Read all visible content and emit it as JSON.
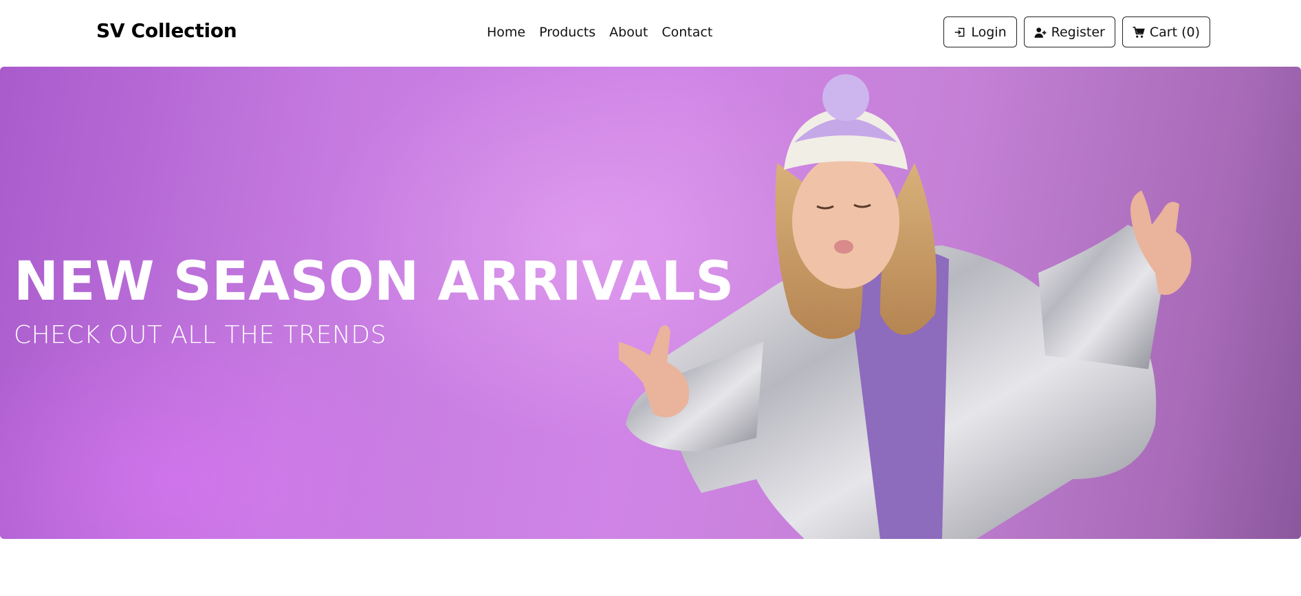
{
  "brand": "SV Collection",
  "nav": {
    "links": [
      "Home",
      "Products",
      "About",
      "Contact"
    ]
  },
  "actions": {
    "login": "Login",
    "register": "Register",
    "cart": "Cart (0)"
  },
  "hero": {
    "title": "NEW SEASON ARRIVALS",
    "subtitle": "CHECK OUT ALL THE TRENDS",
    "image": "woman in silver puffer jacket and white beanie on purple background"
  },
  "colors": {
    "hero_bg": "#c57ae0",
    "hero_text": "#ffffff",
    "button_border": "#222222"
  }
}
